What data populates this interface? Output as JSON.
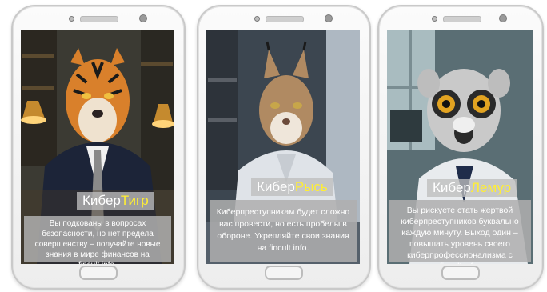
{
  "cards": [
    {
      "title_prefix": "Кибер",
      "title_accent": "Тигр",
      "caption": "Вы подкованы в вопросах безопасности, но нет предела совершенству – получайте новые знания в мире финансов на fincult.info."
    },
    {
      "title_prefix": "Кибер",
      "title_accent": "Рысь",
      "caption": "Киберпреступникам будет сложно вас провести, но есть пробелы в обороне. Укрепляйте свои знания на fincult.info."
    },
    {
      "title_prefix": "Кибер",
      "title_accent": "Лемур",
      "caption": "Вы рискуете стать жертвой киберпреступников буквально каждую минуту. Выход один – повышать уровень своего киберпрофессионализма с fincult.info."
    }
  ],
  "colors": {
    "accent_text": "#ffee33",
    "overlay": "#b4b4b4"
  }
}
